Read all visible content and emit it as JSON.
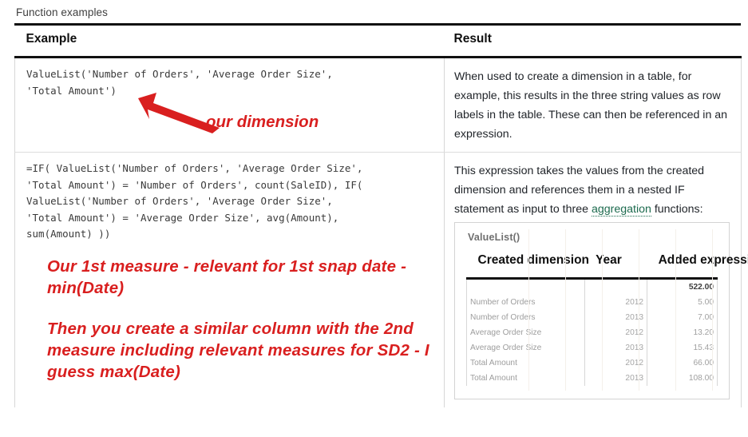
{
  "section": {
    "caption": "Function examples"
  },
  "table": {
    "headers": {
      "example": "Example",
      "result": "Result"
    },
    "rows": [
      {
        "example_code": "ValueList('Number of Orders', 'Average Order Size',\n'Total Amount')",
        "result_text": "When used to create a dimension in a table, for example, this results in the three string values as row labels in the table. These can then be referenced in an expression."
      },
      {
        "example_code": "=IF( ValueList('Number of Orders', 'Average Order Size',\n'Total Amount') = 'Number of Orders', count(SaleID), IF(\nValueList('Number of Orders', 'Average Order Size',\n'Total Amount') = 'Average Order Size', avg(Amount),\nsum(Amount) ))",
        "result_text_before_link": "This expression takes the values from the created dimension and references them in a nested IF statement as input to three ",
        "result_link": "aggregation",
        "result_text_after_link": " functions:"
      }
    ]
  },
  "annotations": {
    "arrow_label": "our dimension",
    "note_1": "Our 1st measure - relevant for 1st snap date - min(Date)",
    "note_2": "Then you create a similar column with the 2nd measure including relevant measures for SD2 - I guess max(Date)",
    "color": "#d91f1f"
  },
  "embedded_table": {
    "title": "ValueList()",
    "columns": [
      "Created dimension",
      "Year",
      "Added expression"
    ],
    "total_row": {
      "dimension": "",
      "year": "",
      "value": "522.00"
    },
    "rows": [
      {
        "dimension": "Number of Orders",
        "year": "2012",
        "value": "5.00"
      },
      {
        "dimension": "Number of Orders",
        "year": "2013",
        "value": "7.00"
      },
      {
        "dimension": "Average Order Size",
        "year": "2012",
        "value": "13.20"
      },
      {
        "dimension": "Average Order Size",
        "year": "2013",
        "value": "15.43"
      },
      {
        "dimension": "Total Amount",
        "year": "2012",
        "value": "66.00"
      },
      {
        "dimension": "Total Amount",
        "year": "2013",
        "value": "108.00"
      }
    ]
  }
}
